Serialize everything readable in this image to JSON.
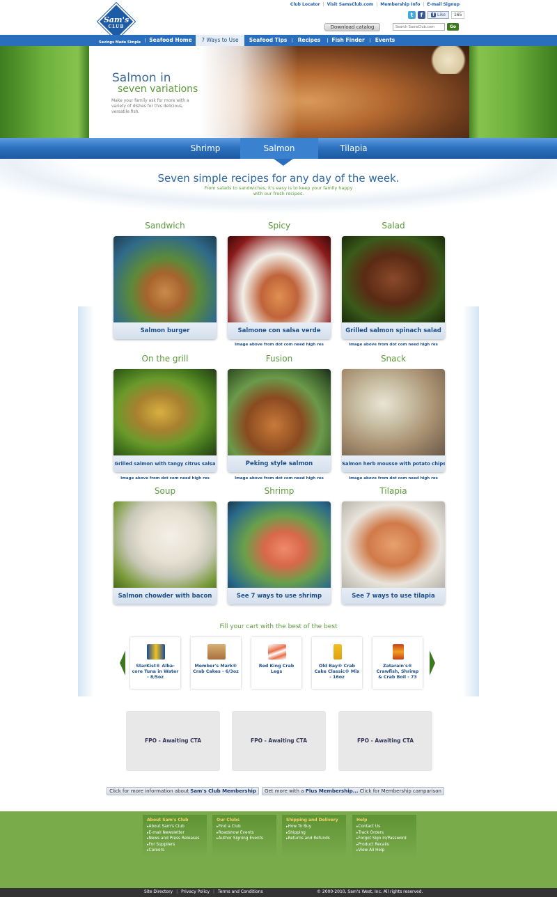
{
  "header": {
    "logo_text": "Sam's",
    "logo_sub": "CLUB",
    "top_links": [
      "Club Locator",
      "Visit SamsClub.com",
      "Membership Info",
      "E-mail Signup"
    ],
    "like_label": "Like",
    "like_count": "165",
    "download_catalog": "Download catalog",
    "search_placeholder": "Search SamsClub.com",
    "go_label": "Go"
  },
  "nav": {
    "tagline": "Savings Made Simple",
    "items": [
      "Seafood Home",
      "7 Ways to Use",
      "Seafood Tips",
      "Recipes",
      "Fish Finder",
      "Events"
    ],
    "active": "7 Ways to Use"
  },
  "hero": {
    "title_line1": "Salmon in",
    "title_line2": "seven variations",
    "description": "Make your family ask for more with a variety of dishes for this delicious, versatile fish."
  },
  "category_tabs": [
    "Shrimp",
    "Salmon",
    "Tilapia"
  ],
  "active_category": "Salmon",
  "headline": "Seven simple recipes for any day of the week.",
  "subheadline_line1": "From salads to sandwiches, it's easy is to keep your family happy",
  "subheadline_line2": "with our fresh recipes.",
  "recipes": [
    {
      "category": "Sandwich",
      "caption": "Salmon burger",
      "note": ""
    },
    {
      "category": "Spicy",
      "caption": "Salmone con salsa verde",
      "note": "Image above from dot com need high res"
    },
    {
      "category": "Salad",
      "caption": "Grilled salmon spinach salad",
      "note": "Image above from dot com need high res"
    },
    {
      "category": "On the grill",
      "caption": "Grilled salmon with tangy citrus salsa",
      "note": "Image above from dot com need high res"
    },
    {
      "category": "Fusion",
      "caption": "Peking style salmon",
      "note": "Image above from dot com need high res"
    },
    {
      "category": "Snack",
      "caption": "Salmon herb mousse with potato chips",
      "note": "Image above from dot com need high res"
    },
    {
      "category": "Soup",
      "caption": "Salmon chowder with bacon",
      "note": ""
    },
    {
      "category": "Shrimp",
      "caption": "See 7 ways to use shrimp",
      "note": ""
    },
    {
      "category": "Tilapia",
      "caption": "See 7 ways to use tilapia",
      "note": ""
    }
  ],
  "products_title": "Fill your cart with the best of the best",
  "products": [
    {
      "name": "StarKist® Alba-core Tuna in Water - 8/5oz"
    },
    {
      "name": "Member's Mark® Crab Cakes - 6/3oz"
    },
    {
      "name": "Red King Crab Legs"
    },
    {
      "name": "Old Bay® Crab Cake Classic® Mix - 16oz"
    },
    {
      "name": "Zatarain's® Crawfish, Shrimp & Crab Boil - 73"
    }
  ],
  "cta": [
    "FPO - Awaiting CTA",
    "FPO - Awaiting CTA",
    "FPO - Awaiting CTA"
  ],
  "membership": {
    "btn1_prefix": "Click for more information about ",
    "btn1_bold": "Sam's Club Membership",
    "btn2_prefix": "Get more with a ",
    "btn2_bold": "Plus Membership...",
    "btn2_suffix": " Click for Membership camparison"
  },
  "footer": {
    "columns": [
      {
        "title": "About Sam's Club",
        "links": [
          "About Sam's Club",
          "E-mail Newsletter",
          "News and Press Releases",
          "For Suppliers",
          "Careers"
        ]
      },
      {
        "title": "Our Clubs",
        "links": [
          "Find a Club",
          "Roadshow Events",
          "Author Signing Events"
        ]
      },
      {
        "title": "Shipping and Delivery",
        "links": [
          "How To Buy",
          "Shipping",
          "Returns and Refunds"
        ]
      },
      {
        "title": "Help",
        "links": [
          "Contact Us",
          "Track Orders",
          "Forgot Sign In/Password",
          "Product Recalls",
          "View All Help"
        ]
      }
    ],
    "bottom_links": [
      "Site Directory",
      "Privacy Policy",
      "Terms and Conditions"
    ],
    "copyright": "© 2000-2010, Sam's West, Inc. All rights reserved."
  },
  "colors": {
    "brand_blue": "#2a6fbd",
    "brand_green": "#5a9a3a",
    "footer_green": "#7aab4a"
  }
}
